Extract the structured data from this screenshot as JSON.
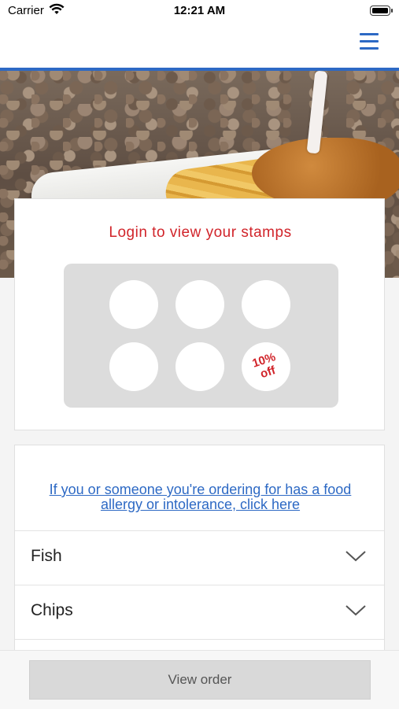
{
  "status_bar": {
    "carrier": "Carrier",
    "time": "12:21 AM",
    "wifi_icon": "wifi-icon",
    "battery_icon": "battery-icon"
  },
  "nav": {
    "menu_icon": "hamburger-menu-icon",
    "accent_color": "#2d69c4"
  },
  "hero": {
    "image": "fish-and-chips-on-pebbles"
  },
  "stamp_card": {
    "title": "Login to view your stamps",
    "stamps_total": 6,
    "reward_line1": "10%",
    "reward_line2": "off",
    "accent_color": "#d1242a"
  },
  "menu": {
    "allergy_link": "If you or someone you're ordering for has a food allergy or intolerance, click here",
    "categories": [
      {
        "label": "Fish"
      },
      {
        "label": "Chips"
      }
    ],
    "chevron_icon": "chevron-down-icon"
  },
  "footer": {
    "view_order_label": "View order"
  }
}
